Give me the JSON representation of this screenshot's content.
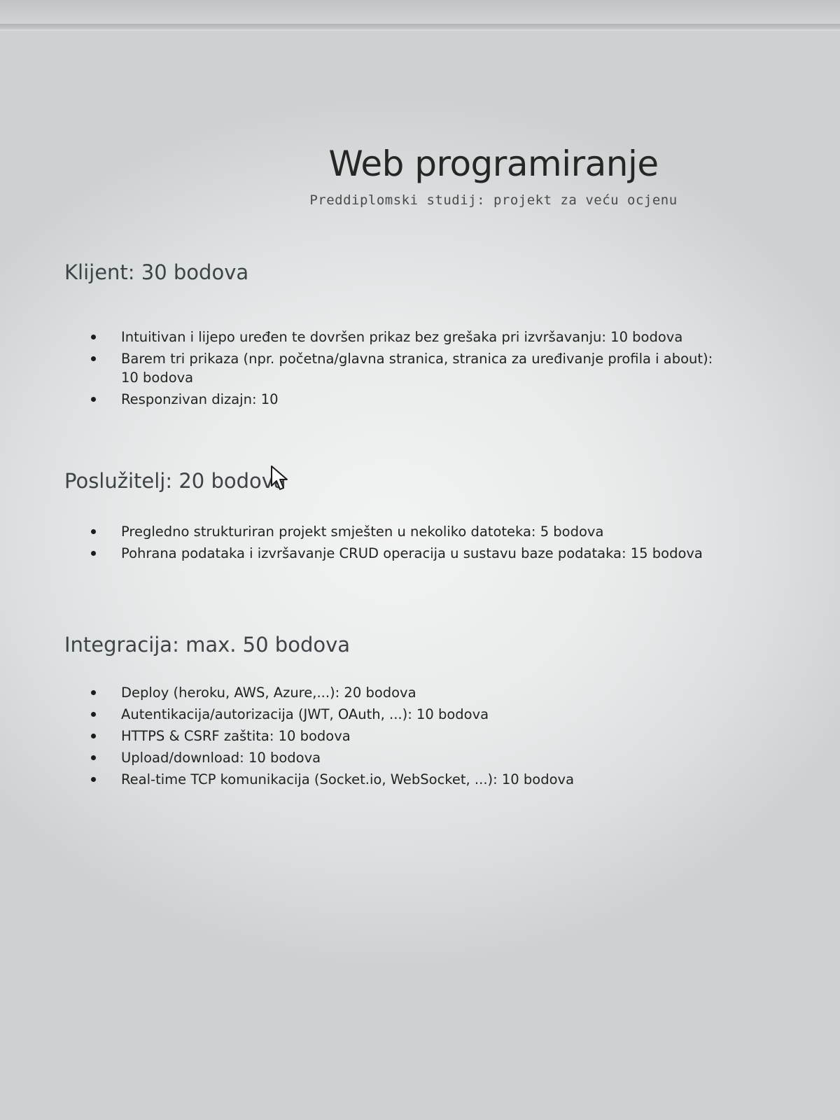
{
  "document": {
    "title": "Web programiranje",
    "subtitle": "Preddiplomski studij: projekt za veću ocjenu"
  },
  "sections": [
    {
      "heading": "Klijent: 30 bodova",
      "items": [
        "Intuitivan i lijepo uređen te dovršen prikaz bez grešaka pri izvršavanju: 10 bodova",
        "Barem tri prikaza (npr. početna/glavna stranica, stranica za uređivanje profila i about): 10 bodova",
        "Responzivan dizajn: 10"
      ]
    },
    {
      "heading": "Poslužitelj: 20 bodova",
      "items": [
        "Pregledno strukturiran projekt smješten u nekoliko datoteka: 5 bodova",
        "Pohrana podataka i izvršavanje CRUD operacija u sustavu baze podataka: 15 bodova"
      ]
    },
    {
      "heading": "Integracija: max. 50 bodova",
      "items": [
        "Deploy (heroku, AWS, Azure,...): 20 bodova",
        "Autentikacija/autorizacija (JWT, OAuth, ...): 10 bodova",
        "HTTPS & CSRF zaštita: 10 bodova",
        "Upload/download: 10 bodova",
        "Real-time TCP komunikacija (Socket.io, WebSocket, ...): 10 bodova"
      ]
    }
  ],
  "icons": {
    "cursor": "mouse-pointer-icon"
  }
}
